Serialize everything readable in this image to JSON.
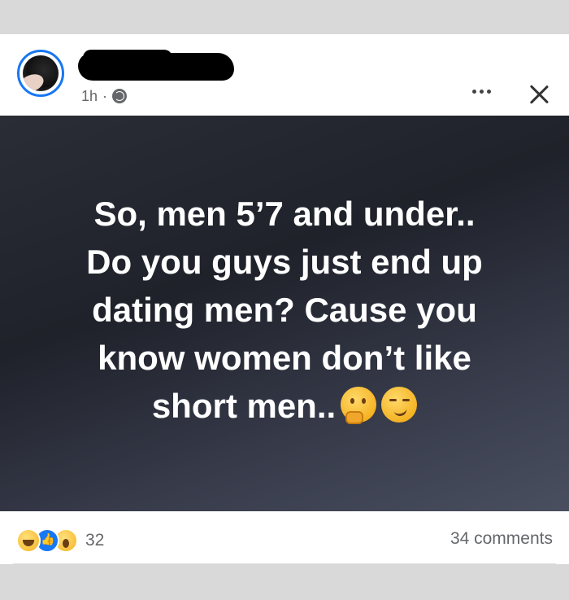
{
  "post": {
    "time": "1h",
    "separator": "·",
    "privacy_icon": "globe-icon",
    "text_lines": [
      "So, men 5’7 and under..",
      "Do you guys just end up",
      "dating men? Cause you",
      "know women don’t like",
      "short men.."
    ],
    "trailing_emojis": [
      "thinking-face",
      "smirking-face"
    ]
  },
  "footer": {
    "reaction_icons": [
      "haha-reaction-icon",
      "like-reaction-icon",
      "wow-reaction-icon"
    ],
    "reaction_count": "32",
    "comments_label": "34 comments"
  },
  "colors": {
    "accent": "#1877f2",
    "meta_text": "#65676b",
    "post_text": "#ffffff"
  }
}
